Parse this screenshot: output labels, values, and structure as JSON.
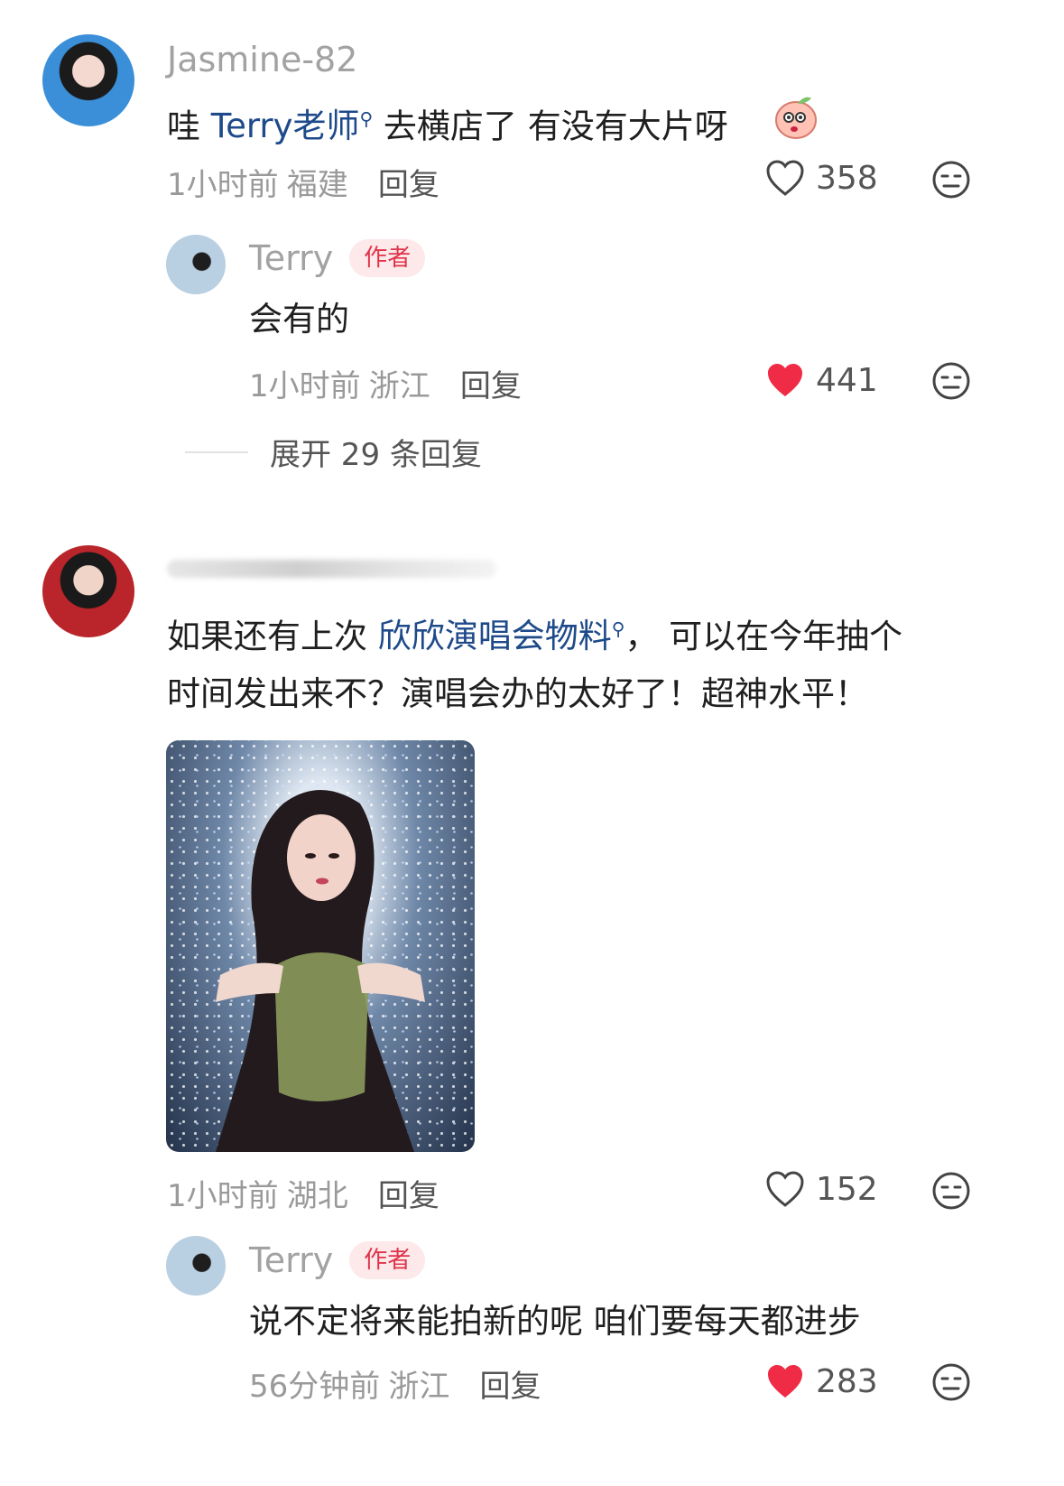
{
  "comments": [
    {
      "username": "Jasmine-82",
      "text_before": "哇 ",
      "mention": "Terry老师",
      "text_after": " 去横店了 有没有大片呀",
      "emoji": "peach-emoji",
      "time": "1小时前",
      "location": "福建",
      "reply_label": "回复",
      "likes": "358",
      "liked": false,
      "replies": [
        {
          "username": "Terry",
          "badge": "作者",
          "text": "会有的",
          "time": "1小时前",
          "location": "浙江",
          "reply_label": "回复",
          "likes": "441",
          "liked": true
        }
      ],
      "expand_label": "展开 29 条回复"
    },
    {
      "username": "",
      "text_line1_before": "如果还有上次 ",
      "mention": "欣欣演唱会物料",
      "text_line1_after": "， 可以在今年抽个",
      "text_line2": "时间发出来不？演唱会办的太好了！超神水平！",
      "time": "1小时前",
      "location": "湖北",
      "reply_label": "回复",
      "likes": "152",
      "liked": false,
      "replies": [
        {
          "username": "Terry",
          "badge": "作者",
          "text": "说不定将来能拍新的呢 咱们要每天都进步",
          "time": "56分钟前",
          "location": "浙江",
          "reply_label": "回复",
          "likes": "283",
          "liked": true
        }
      ]
    }
  ],
  "colors": {
    "mention": "#1e4a8a",
    "like_active": "#ef2b45",
    "badge_bg": "#fde8ea",
    "badge_text": "#e0344a"
  },
  "icons": {
    "like": "heart-icon",
    "dislike": "neutral-face-icon",
    "mention_search": "search-icon"
  }
}
